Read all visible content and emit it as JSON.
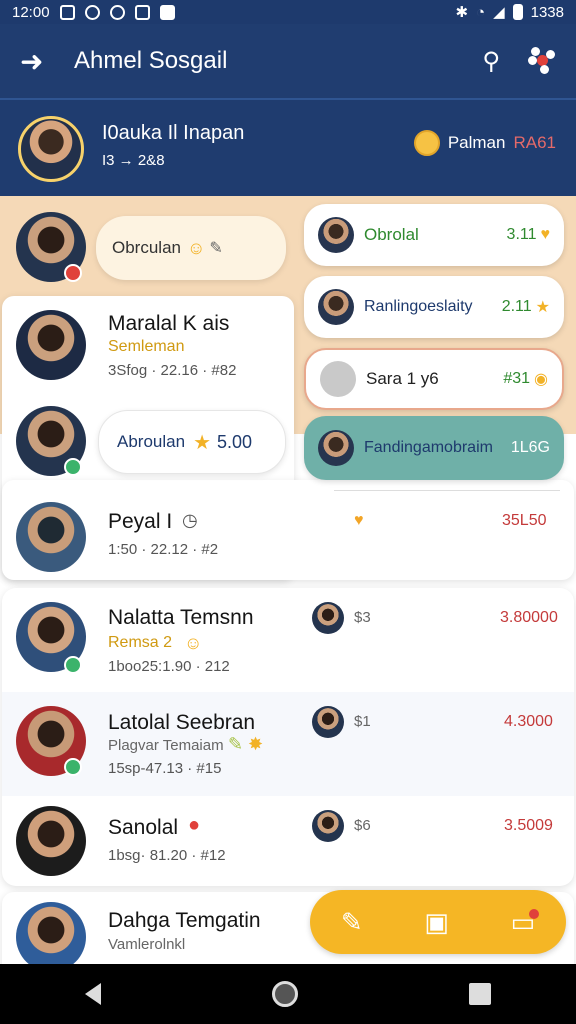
{
  "status_bar": {
    "time": "12:00",
    "right_text": "1338"
  },
  "app_bar": {
    "title": "Ahmel Sosgail",
    "back_icon": "back-arrow-icon",
    "search_icon": "search-icon",
    "menu_icon": "dots-cluster-icon"
  },
  "profile": {
    "name": "I0auka Il Inapan",
    "stats": "I3 → 2&8",
    "coin_label": "Palman",
    "coin_value": "RA61"
  },
  "top_row": {
    "pill_label": "Obrculan"
  },
  "chips": [
    {
      "label": "Obrolal",
      "value": "3.11",
      "label_color": "#2f8a2f",
      "value_color": "#2f8a2f"
    },
    {
      "label": "Ranlingoeslaity",
      "value": "2.11",
      "label_color": "#1e3a6d",
      "value_color": "#2f8a2f"
    },
    {
      "label": "Sara 1 y6",
      "value": "#31",
      "label_color": "#222222",
      "value_color": "#2f8a2f"
    },
    {
      "label": "Fandingamobraim",
      "value": "1L6G",
      "label_color": "#1e3a6d",
      "value_color": "#ffffff"
    }
  ],
  "featured": {
    "name": "Maralal K ais",
    "tag": "Semleman",
    "meta": "3Sfog · 22.16 · #82"
  },
  "rating_pill": {
    "label": "Abroulan",
    "value": "5.00"
  },
  "rows": [
    {
      "name": "Peyal I",
      "tag": "",
      "meta": "1:50 · 22.12 · #2",
      "count": "",
      "value": "35L50"
    },
    {
      "name": "Nalatta Temsnn",
      "tag": "Remsa 2",
      "meta": "1boo25:1.90 · 212",
      "count": "$3",
      "value": "3.80000"
    },
    {
      "name": "Latolal Seebran",
      "tag": "Plagvar Temaiam",
      "meta": "15sp-47.13 · #15",
      "count": "$1",
      "value": "4.3000"
    },
    {
      "name": "Sanolal",
      "tag": "",
      "meta": "1bsg· 81.20 · #12",
      "count": "$6",
      "value": "3.5009"
    },
    {
      "name": "Dahga Temgatin",
      "tag": "Vamlerolnkl",
      "meta": "",
      "count": "",
      "value": ""
    }
  ]
}
